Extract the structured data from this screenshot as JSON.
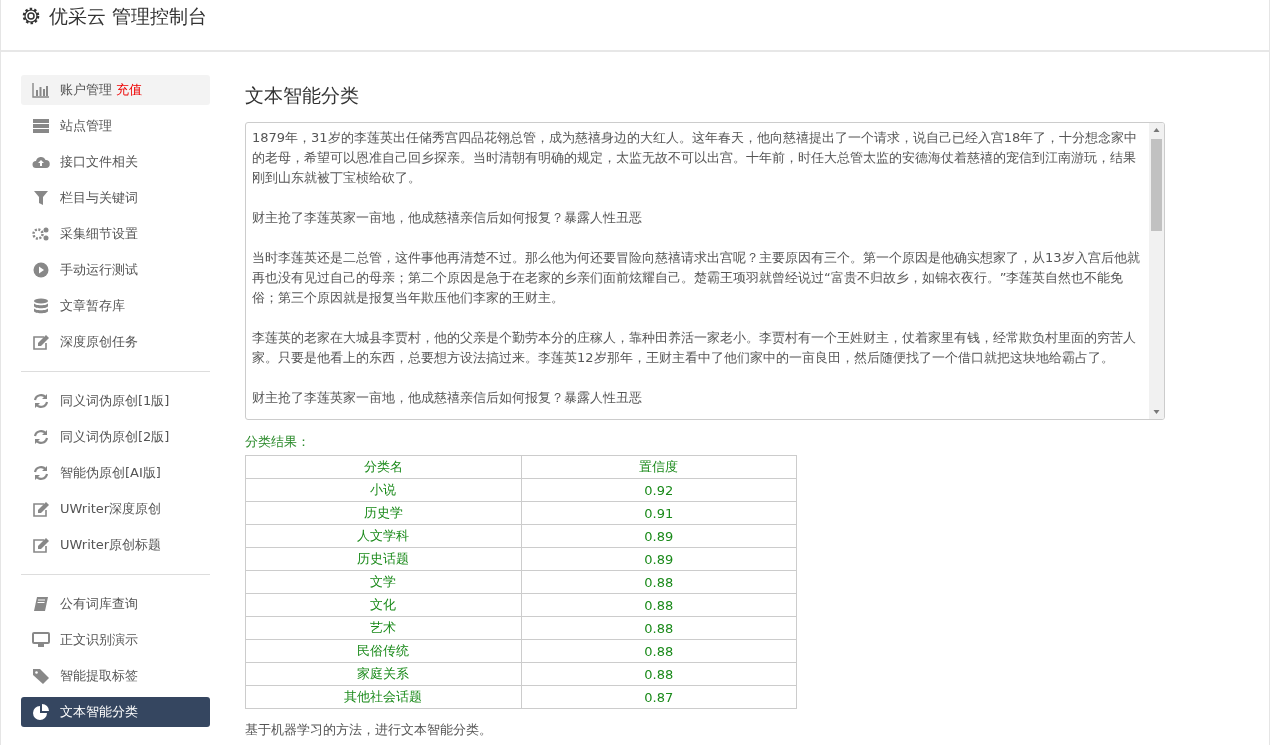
{
  "header": {
    "title": "优采云 管理控制台"
  },
  "sidebar": {
    "groups": [
      [
        {
          "label": "账户管理",
          "badge": "充值",
          "kind": "chart",
          "selected": false,
          "hover": true
        },
        {
          "label": "站点管理",
          "kind": "server",
          "selected": false,
          "hover": false
        },
        {
          "label": "接口文件相关",
          "kind": "cloud",
          "selected": false,
          "hover": false
        },
        {
          "label": "栏目与关键词",
          "kind": "filter",
          "selected": false,
          "hover": false
        },
        {
          "label": "采集细节设置",
          "kind": "gears",
          "selected": false,
          "hover": false
        },
        {
          "label": "手动运行测试",
          "kind": "play",
          "selected": false,
          "hover": false
        },
        {
          "label": "文章暂存库",
          "kind": "database",
          "selected": false,
          "hover": false
        },
        {
          "label": "深度原创任务",
          "kind": "edit",
          "selected": false,
          "hover": false
        }
      ],
      [
        {
          "label": "同义词伪原创[1版]",
          "kind": "refresh",
          "selected": false,
          "hover": false
        },
        {
          "label": "同义词伪原创[2版]",
          "kind": "refresh",
          "selected": false,
          "hover": false
        },
        {
          "label": "智能伪原创[AI版]",
          "kind": "refresh",
          "selected": false,
          "hover": false
        },
        {
          "label": "UWriter深度原创",
          "kind": "edit",
          "selected": false,
          "hover": false
        },
        {
          "label": "UWriter原创标题",
          "kind": "edit",
          "selected": false,
          "hover": false
        }
      ],
      [
        {
          "label": "公有词库查询",
          "kind": "book",
          "selected": false,
          "hover": false
        },
        {
          "label": "正文识别演示",
          "kind": "monitor",
          "selected": false,
          "hover": false
        },
        {
          "label": "智能提取标签",
          "kind": "tag",
          "selected": false,
          "hover": false
        },
        {
          "label": "文本智能分类",
          "kind": "pie",
          "selected": true,
          "hover": false
        }
      ]
    ]
  },
  "main": {
    "title": "文本智能分类",
    "article": [
      "1879年，31岁的李莲英出任储秀宫四品花翎总管，成为慈禧身边的大红人。这年春天，他向慈禧提出了一个请求，说自己已经入宫18年了，十分想念家中的老母，希望可以恩准自己回乡探亲。当时清朝有明确的规定，太监无故不可以出宫。十年前，时任大总管太监的安德海仗着慈禧的宠信到江南游玩，结果刚到山东就被丁宝桢给砍了。",
      "财主抢了李莲英家一亩地，他成慈禧亲信后如何报复？暴露人性丑恶",
      "当时李莲英还是二总管，这件事他再清楚不过。那么他为何还要冒险向慈禧请求出宫呢？主要原因有三个。第一个原因是他确实想家了，从13岁入宫后他就再也没有见过自己的母亲；第二个原因是急于在老家的乡亲们面前炫耀自己。楚霸王项羽就曾经说过“富贵不归故乡，如锦衣夜行。”李莲英自然也不能免俗；第三个原因就是报复当年欺压他们李家的王财主。",
      "李莲英的老家在大城县李贾村，他的父亲是个勤劳本分的庄稼人，靠种田养活一家老小。李贾村有一个王姓财主，仗着家里有钱，经常欺负村里面的穷苦人家。只要是他看上的东西，总要想方设法搞过来。李莲英12岁那年，王财主看中了他们家中的一亩良田，然后随便找了一个借口就把这块地给霸占了。",
      "财主抢了李莲英家一亩地，他成慈禧亲信后如何报复？暴露人性丑恶"
    ],
    "result_label": "分类结果：",
    "table": {
      "columns": [
        "分类名",
        "置信度"
      ],
      "rows": [
        [
          "小说",
          "0.92"
        ],
        [
          "历史学",
          "0.91"
        ],
        [
          "人文学科",
          "0.89"
        ],
        [
          "历史话题",
          "0.89"
        ],
        [
          "文学",
          "0.88"
        ],
        [
          "文化",
          "0.88"
        ],
        [
          "艺术",
          "0.88"
        ],
        [
          "民俗传统",
          "0.88"
        ],
        [
          "家庭关系",
          "0.88"
        ],
        [
          "其他社会话题",
          "0.87"
        ]
      ]
    },
    "note": "基于机器学习的方法，进行文本智能分类。"
  }
}
